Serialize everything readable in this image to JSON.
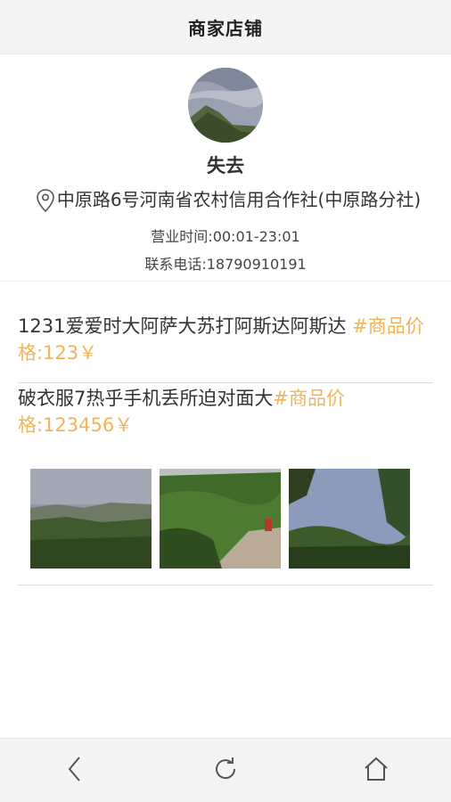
{
  "header": {
    "title": "商家店铺"
  },
  "shop": {
    "name": "失去",
    "address": "中原路6号河南省农村信用合作社(中原路分社)",
    "hours": "营业时间:00:01-23:01",
    "phone": "联系电话:18790910191"
  },
  "posts": [
    {
      "text": "1231爱爱时大阿萨大苏打阿斯达阿斯达 ",
      "price": "#商品价格:123￥"
    },
    {
      "text": "破衣服7热乎手机丢所迫对面大",
      "price": "#商品价格:123456￥"
    }
  ],
  "bottom_nav": {
    "back_icon": "chevron-left-icon",
    "refresh_icon": "refresh-icon",
    "home_icon": "home-icon"
  },
  "colors": {
    "price": "#f0b45a",
    "bar_bg": "#f4f4f4"
  }
}
